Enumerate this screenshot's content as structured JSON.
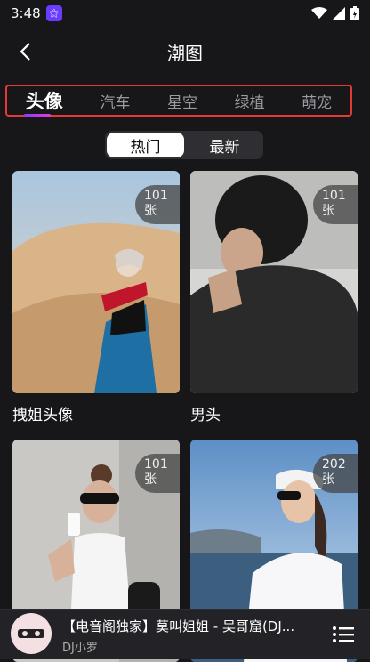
{
  "status": {
    "time": "3:48"
  },
  "header": {
    "title": "潮图"
  },
  "tabs": [
    {
      "label": "头像",
      "active": true
    },
    {
      "label": "汽车",
      "active": false
    },
    {
      "label": "星空",
      "active": false
    },
    {
      "label": "绿植",
      "active": false
    },
    {
      "label": "萌宠",
      "active": false
    }
  ],
  "segment": {
    "hot": "热门",
    "new": "最新"
  },
  "cards": [
    {
      "caption": "拽姐头像",
      "count_num": "101",
      "count_unit": "张"
    },
    {
      "caption": "男头",
      "count_num": "101",
      "count_unit": "张"
    },
    {
      "caption": "",
      "count_num": "101",
      "count_unit": "张"
    },
    {
      "caption": "",
      "count_num": "202",
      "count_unit": "张"
    }
  ],
  "player": {
    "song": "【电音阁独家】莫叫姐姐 - 吴哥窟(DJ...",
    "artist": "DJ小罗"
  },
  "colors": {
    "accent": "#8a3cff",
    "highlight_border": "#e53935",
    "background": "#17171a"
  }
}
